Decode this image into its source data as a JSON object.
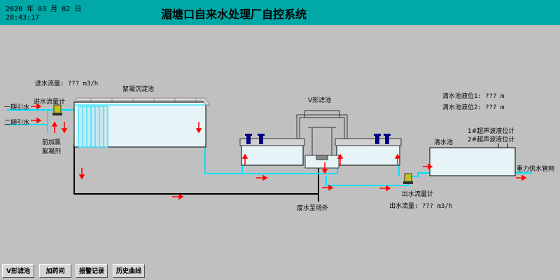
{
  "header": {
    "date": "2020 年 03 月 02 日",
    "time": "20:43:17",
    "title": "湄塘口自来水处理厂自控系统"
  },
  "labels": {
    "inflow_rate": "进水流量: ??? m3/h",
    "inflow_meter": "进水流量计",
    "phase1_intake": "一期引水",
    "phase2_intake": "二期引水",
    "pre_chlorination": "前加氯",
    "coagulant": "絮凝剂",
    "floc_tank": "絮凝沉淀池",
    "v_filter": "V形滤池",
    "clear_well": "清水池",
    "clear_level_1": "清水池液位1: ???  m",
    "clear_level_2": "清水池液位2: ???  m",
    "ultrasonic_1": "1#超声波液位计",
    "ultrasonic_2": "2#超声波液位计",
    "gravity_main": "重力供水管网",
    "outflow_meter": "出水流量计",
    "outflow_rate": "出水流量: ???  m3/h",
    "waste_water": "废水至场外"
  },
  "buttons": [
    "V形滤池",
    "加药间",
    "报警记录",
    "历史曲线"
  ],
  "colors": {
    "header_bg": "#00a8a8",
    "background": "#c0c0c0",
    "tank_fill": "#e6f4f7",
    "water_pipe": "#00e0ff",
    "waste_pipe": "#000000",
    "flow_arrow": "#ff0000",
    "valve_blue": "#000080",
    "meter_yellow": "#c0c020"
  }
}
